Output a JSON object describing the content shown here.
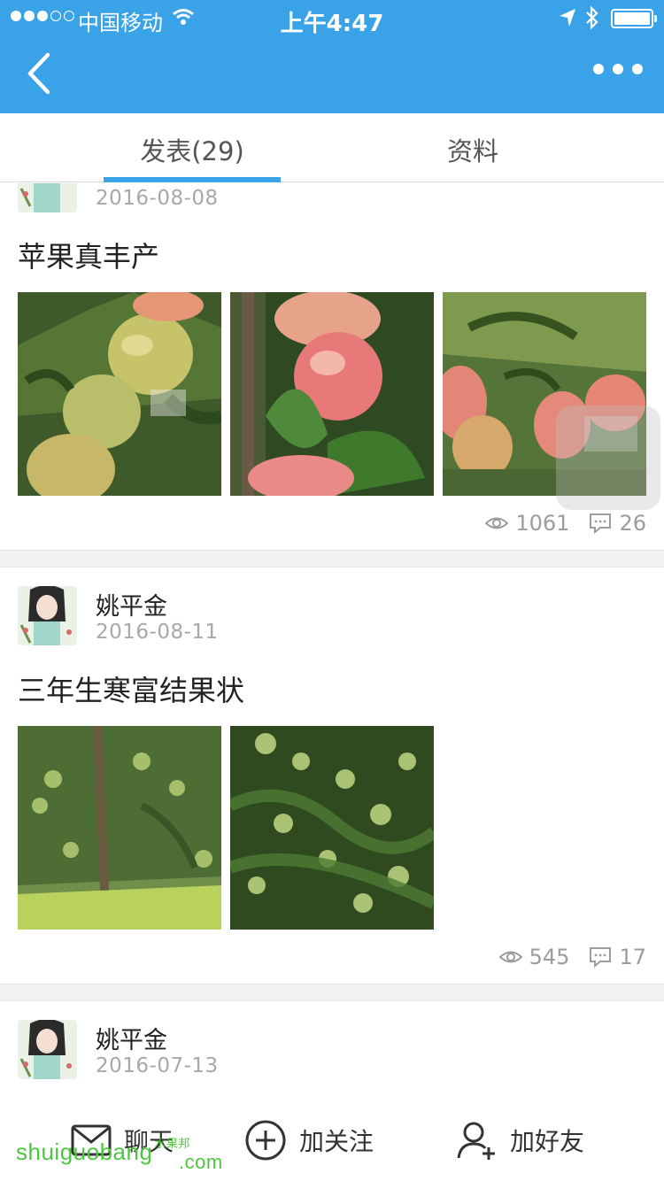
{
  "status_bar": {
    "carrier": "中国移动",
    "time": "上午4:47"
  },
  "tabs": [
    {
      "label": "发表(29)",
      "active": true
    },
    {
      "label": "资料",
      "active": false
    }
  ],
  "posts": [
    {
      "author": "",
      "date": "2016-08-08",
      "title": "苹果真丰产",
      "images": [
        "apple-photo-1",
        "apple-photo-2",
        "apple-photo-3"
      ],
      "views": "1061",
      "comments": "26"
    },
    {
      "author": "姚平金",
      "date": "2016-08-11",
      "title": "三年生寒富结果状",
      "images": [
        "tree-photo-1",
        "tree-photo-2"
      ],
      "views": "545",
      "comments": "17"
    },
    {
      "author": "姚平金",
      "date": "2016-07-13",
      "title": "",
      "images": [],
      "views": "",
      "comments": ""
    }
  ],
  "bottom_bar": {
    "chat": "聊天",
    "follow": "加关注",
    "add_friend": "加好友"
  },
  "watermark": {
    "text": "shuiguobang",
    "small": "水果邦",
    "com": ".com"
  },
  "colors": {
    "accent": "#3aa3e8",
    "muted": "#a8a8a8",
    "watermark": "#4fc640"
  }
}
